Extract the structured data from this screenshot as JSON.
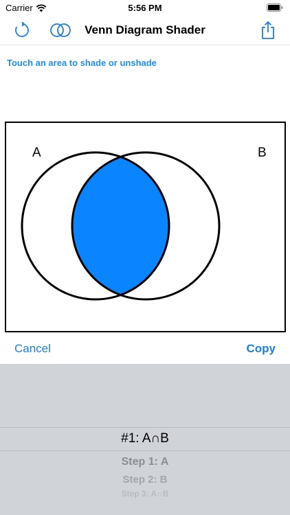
{
  "status_bar": {
    "carrier": "Carrier",
    "time": "5:56 PM",
    "wifi_icon": "wifi-icon",
    "battery_icon": "battery-icon"
  },
  "nav": {
    "title": "Venn Diagram Shader",
    "refresh_icon": "refresh-icon",
    "venn_icon": "venn-icon",
    "share_icon": "share-icon",
    "accent_color": "#1a7fe0"
  },
  "instruction": "Touch an area to shade or unshade",
  "diagram": {
    "label_a": "A",
    "label_b": "B",
    "shaded_region": "intersection",
    "shade_color": "#0a84ff"
  },
  "toolbar": {
    "cancel_label": "Cancel",
    "copy_label": "Copy"
  },
  "picker": {
    "selected": "#1:  A∩B",
    "options": [
      "Step 1: A",
      "Step 2: B",
      "Step 3: A∩B"
    ]
  }
}
